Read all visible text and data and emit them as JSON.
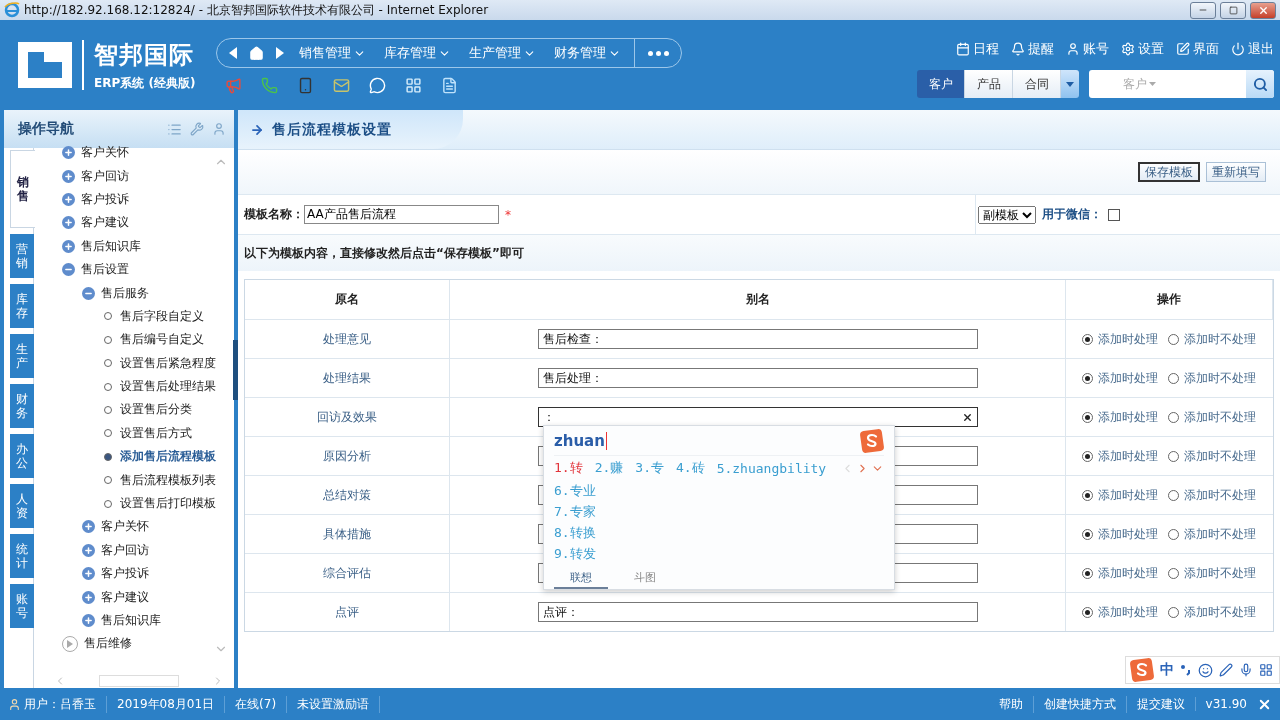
{
  "window": {
    "title": "http://182.92.168.12:12824/ - 北京智邦国际软件技术有限公司 - Internet Explorer"
  },
  "brand": {
    "name": "智邦国际",
    "subtitle": "ERP系统 (经典版)"
  },
  "main_menu": [
    {
      "label": "销售管理"
    },
    {
      "label": "库存管理"
    },
    {
      "label": "生产管理"
    },
    {
      "label": "财务管理"
    }
  ],
  "top_links": [
    {
      "kind": "calendar",
      "label": "日程"
    },
    {
      "kind": "bell",
      "label": "提醒"
    },
    {
      "kind": "user",
      "label": "账号"
    },
    {
      "kind": "gear",
      "label": "设置"
    },
    {
      "kind": "pen",
      "label": "界面"
    },
    {
      "kind": "power",
      "label": "退出"
    }
  ],
  "search": {
    "tabs": [
      {
        "label": "客户",
        "selected": true
      },
      {
        "label": "产品",
        "selected": false
      },
      {
        "label": "合同",
        "selected": false
      }
    ],
    "scope": "客户"
  },
  "sidebar": {
    "title": "操作导航",
    "tabs": [
      {
        "label": "销售",
        "selected": true
      },
      {
        "label": "营销",
        "selected": false
      },
      {
        "label": "库存",
        "selected": false
      },
      {
        "label": "生产",
        "selected": false
      },
      {
        "label": "财务",
        "selected": false
      },
      {
        "label": "办公",
        "selected": false
      },
      {
        "label": "人资",
        "selected": false
      },
      {
        "label": "统计",
        "selected": false
      },
      {
        "label": "账号",
        "selected": false
      }
    ],
    "tree": [
      {
        "label": "客户关怀",
        "expanded": false
      },
      {
        "label": "客户回访",
        "expanded": false
      },
      {
        "label": "客户投诉",
        "expanded": false
      },
      {
        "label": "客户建议",
        "expanded": false
      },
      {
        "label": "售后知识库",
        "expanded": false
      },
      {
        "label": "售后设置",
        "expanded": true,
        "children": [
          {
            "label": "售后服务",
            "expanded": true,
            "children": [
              {
                "label": "售后字段自定义",
                "selected": false
              },
              {
                "label": "售后编号自定义",
                "selected": false
              },
              {
                "label": "设置售后紧急程度",
                "selected": false
              },
              {
                "label": "设置售后处理结果",
                "selected": false
              },
              {
                "label": "设置售后分类",
                "selected": false
              },
              {
                "label": "设置售后方式",
                "selected": false
              },
              {
                "label": "添加售后流程模板",
                "selected": true
              },
              {
                "label": "售后流程模板列表",
                "selected": false
              },
              {
                "label": "设置售后打印模板",
                "selected": false
              }
            ]
          },
          {
            "label": "客户关怀",
            "expanded": false
          },
          {
            "label": "客户回访",
            "expanded": false
          },
          {
            "label": "客户投诉",
            "expanded": false
          },
          {
            "label": "客户建议",
            "expanded": false
          },
          {
            "label": "售后知识库",
            "expanded": false
          }
        ]
      }
    ],
    "sections": [
      {
        "label": "售后维修"
      }
    ]
  },
  "page": {
    "title": "售后流程模板设置",
    "buttons": [
      "保存模板",
      "重新填写"
    ],
    "name_label": "模板名称：",
    "name_value": "AA产品售后流程",
    "required": "*",
    "template_type": "副模板",
    "wechat_label": "用于微信：",
    "wechat_checked": false,
    "hint": "以下为模板内容，直接修改然后点击“保存模板”即可"
  },
  "table": {
    "columns": [
      "原名",
      "别名",
      "操作"
    ],
    "rows": [
      {
        "name": "处理意见",
        "alias": "售后检查：",
        "options": [
          {
            "label": "添加时处理",
            "selected": true
          },
          {
            "label": "添加时不处理",
            "selected": false
          }
        ]
      },
      {
        "name": "处理结果",
        "alias": "售后处理：",
        "options": [
          {
            "label": "添加时处理",
            "selected": true
          },
          {
            "label": "添加时不处理",
            "selected": false
          }
        ]
      },
      {
        "name": "回访及效果",
        "alias": "：",
        "focused": true,
        "options": [
          {
            "label": "添加时处理",
            "selected": true
          },
          {
            "label": "添加时不处理",
            "selected": false
          }
        ]
      },
      {
        "name": "原因分析",
        "options": [
          {
            "label": "添加时处理",
            "selected": true
          },
          {
            "label": "添加时不处理",
            "selected": false
          }
        ]
      },
      {
        "name": "总结对策",
        "options": [
          {
            "label": "添加时处理",
            "selected": true
          },
          {
            "label": "添加时不处理",
            "selected": false
          }
        ]
      },
      {
        "name": "具体措施",
        "options": [
          {
            "label": "添加时处理",
            "selected": true
          },
          {
            "label": "添加时不处理",
            "selected": false
          }
        ]
      },
      {
        "name": "综合评估",
        "options": [
          {
            "label": "添加时处理",
            "selected": true
          },
          {
            "label": "添加时不处理",
            "selected": false
          }
        ]
      },
      {
        "name": "点评",
        "alias": "点评：",
        "options": [
          {
            "label": "添加时处理",
            "selected": true
          },
          {
            "label": "添加时不处理",
            "selected": false
          }
        ]
      }
    ]
  },
  "ime": {
    "input": "zhuan",
    "candidates": [
      {
        "label": "1.转",
        "selected": true
      },
      {
        "label": "2.赚",
        "selected": false
      },
      {
        "label": "3.专",
        "selected": false
      },
      {
        "label": "4.砖",
        "selected": false
      },
      {
        "label": "5.zhuangbility",
        "selected": false
      }
    ],
    "more_candidates": [
      {
        "label": "6.专业",
        "selected": false
      },
      {
        "label": "7.专家",
        "selected": false
      },
      {
        "label": "8.转换",
        "selected": false
      },
      {
        "label": "9.转发",
        "selected": false
      }
    ],
    "tabs": [
      {
        "label": "联想",
        "selected": true
      },
      {
        "label": "斗图",
        "selected": false
      }
    ],
    "toolbar_label": "中"
  },
  "status_bar": {
    "user": "用户：吕香玉",
    "items": [
      "2019年08月01日",
      "在线(7)",
      "未设置激励语"
    ],
    "links": [
      "帮助",
      "创建快捷方式",
      "提交建议",
      "v31.90"
    ]
  }
}
